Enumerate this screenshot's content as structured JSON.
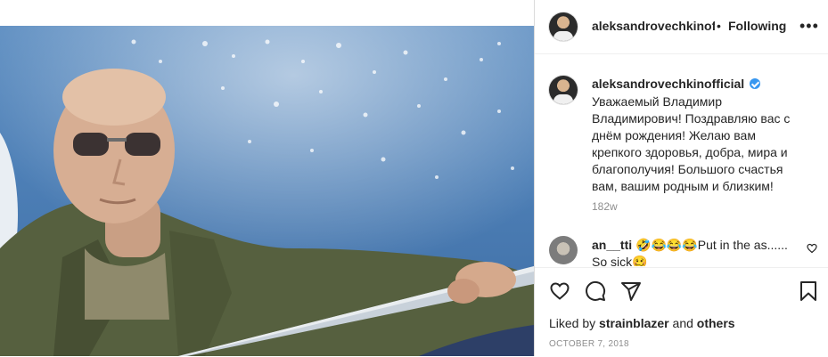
{
  "header": {
    "username": "aleksandrovechkinof",
    "separator": "•",
    "follow_label": "Following",
    "more_icon": "more-horizontal-icon",
    "more_glyph": "•••"
  },
  "caption": {
    "username": "aleksandrovechkinofficial",
    "verified_icon": "verified-badge-icon",
    "text": "Уважаемый Владимир Владимирович! Поздравляю вас с днём рождения! Желаю вам крепкого здоровья, добра, мира и благополучия! Большого счастья вам, вашим родным и близким!",
    "time_ago": "182w"
  },
  "comment": {
    "username": "an__tti",
    "text": "🤣😂😂😂Put in the as......\nSo sick🥴",
    "like_icon": "heart-outline-icon"
  },
  "actions": {
    "icons": [
      "heart-outline-icon",
      "comment-icon",
      "share-icon",
      "bookmark-icon"
    ],
    "liked_prefix": "Liked by",
    "liked_user": "strainblazer",
    "liked_and": "and",
    "liked_others": "others",
    "date": "OCTOBER 7, 2018"
  },
  "colors": {
    "text": "#262626",
    "muted": "#8e8e8e",
    "verified": "#3897f0",
    "border": "#dbdbdb"
  }
}
